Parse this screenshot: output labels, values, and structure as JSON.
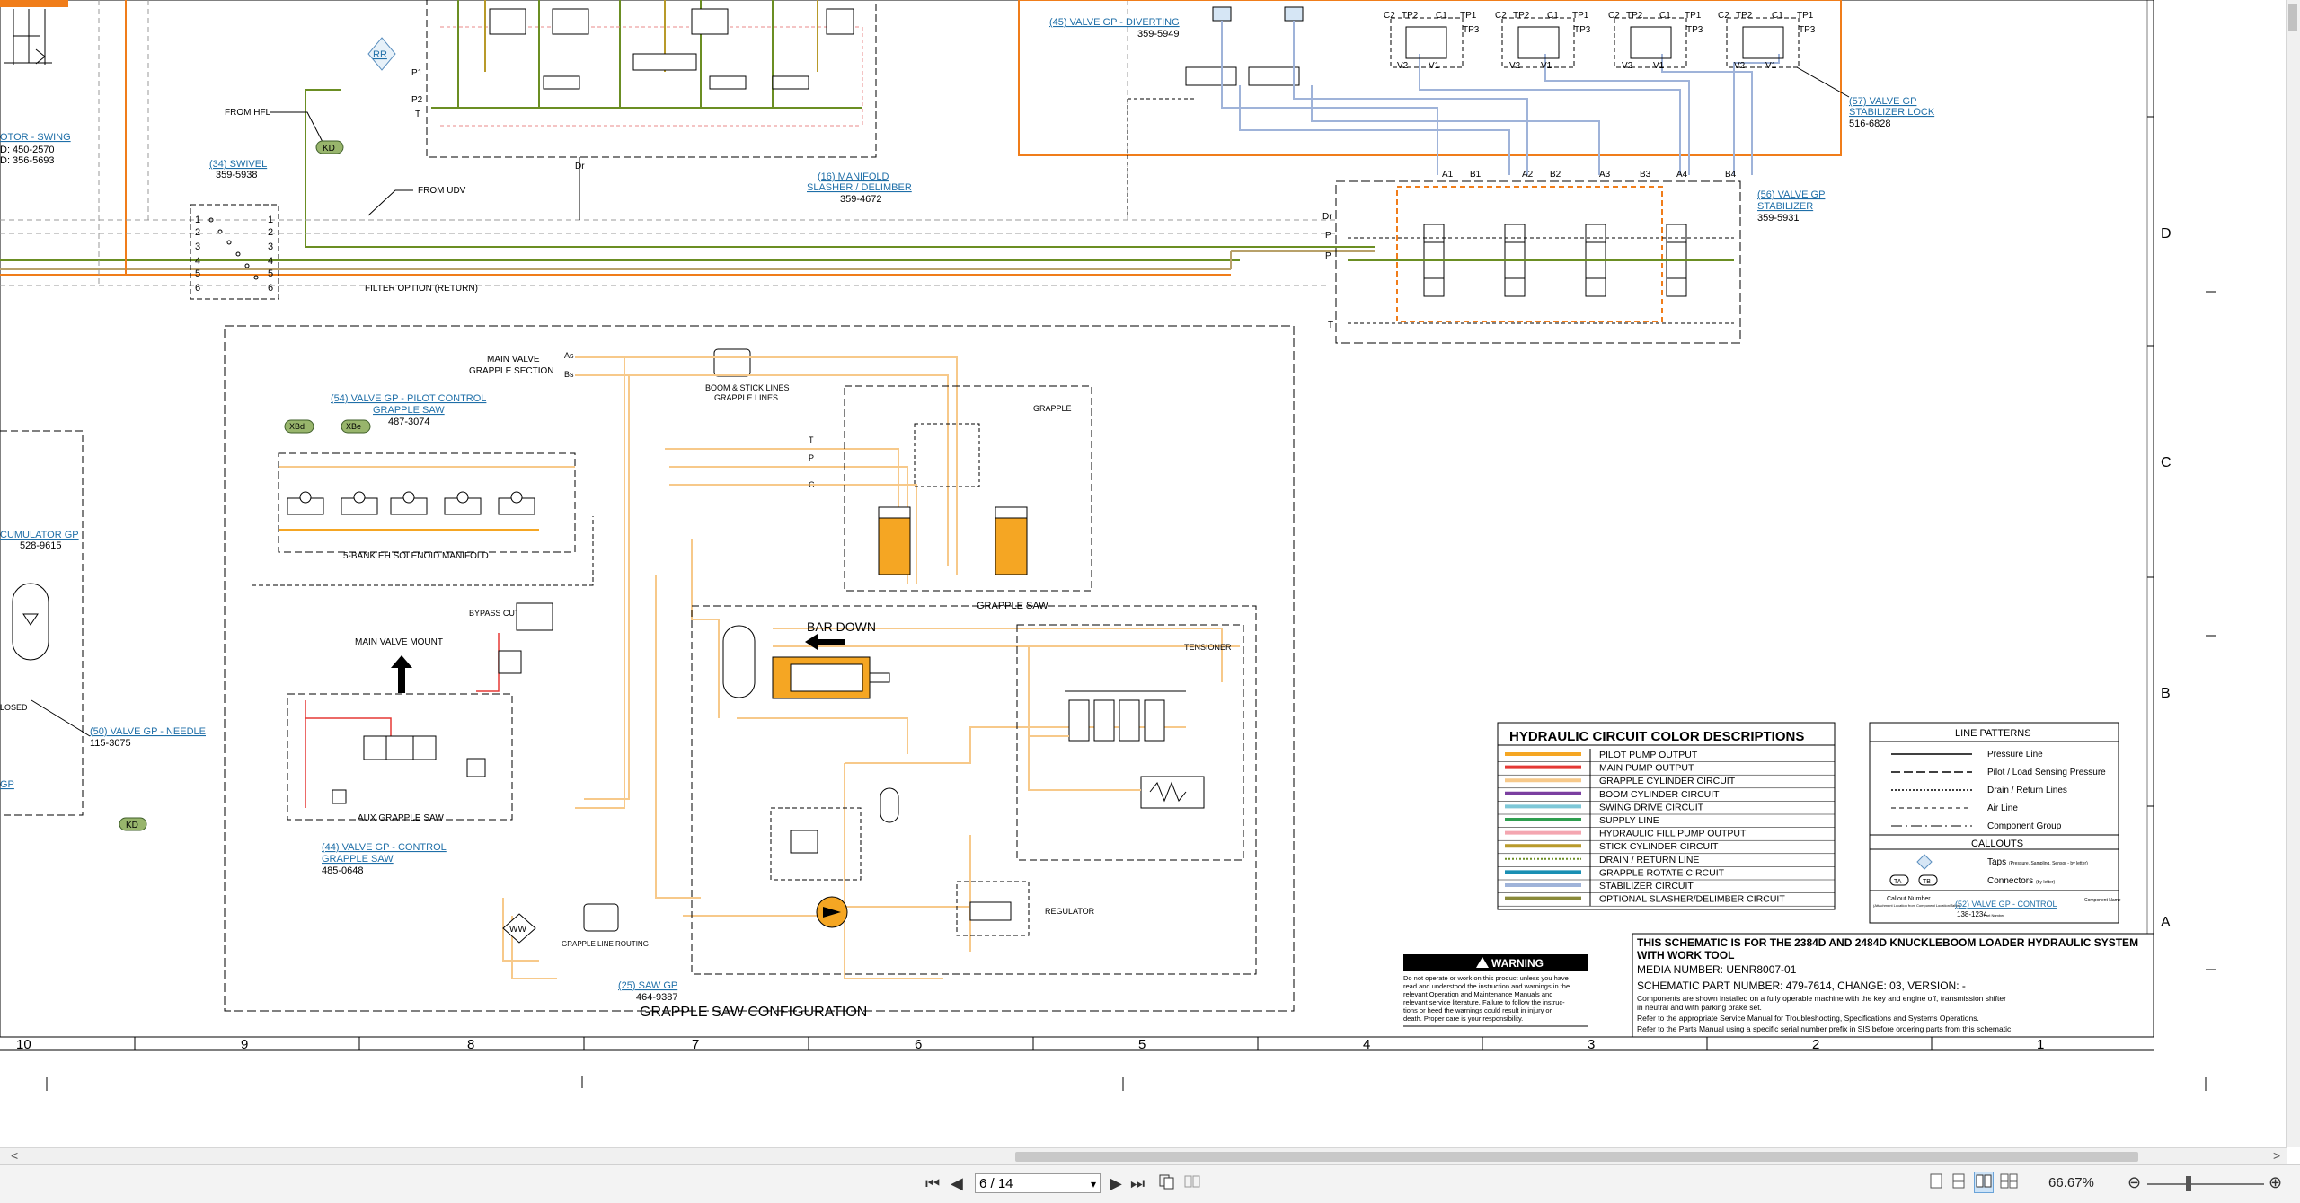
{
  "viewer": {
    "page_current": "6 / 14",
    "zoom": "66.67%",
    "buttons": {
      "first_page": "⏮",
      "prev_page": "◀",
      "next_page": "▶",
      "last_page": "⏭",
      "page_dropdown": "▾",
      "zoom_out": "⊖",
      "zoom_in": "⊕"
    },
    "scroll_left": "<",
    "scroll_right": ">"
  },
  "schematic": {
    "labels": {
      "motor_swing": "OTOR - SWING",
      "motor_part1": "D: 450-2570",
      "motor_part2": "D: 356-5693",
      "rr": "RR",
      "from_hfl": "FROM HFL",
      "kd1": "KD",
      "kd2": "KD",
      "swivel": "(34) SWIVEL",
      "swivel_part": "359-5938",
      "from_udv": "FROM UDV",
      "filter_option": "FILTER OPTION (RETURN)",
      "dr1": "Dr",
      "manifold": "(16) MANIFOLD",
      "manifold2": "SLASHER / DELIMBER",
      "manifold_part": "359-4672",
      "valve_diverting": "(45) VALVE GP - DIVERTING",
      "valve_diverting_part": "359-5949",
      "stab_lock": "(57) VALVE GP",
      "stab_lock2": "STABILIZER LOCK",
      "stab_lock_part": "516-6828",
      "valve_stab": "(56) VALVE GP",
      "valve_stab2": "STABILIZER",
      "valve_stab_part": "359-5931",
      "main_valve": "MAIN VALVE",
      "grapple_section": "GRAPPLE SECTION",
      "boom_stick": "BOOM & STICK LINES",
      "grapple_lines": "GRAPPLE LINES",
      "pilot_control": "(54) VALVE GP - PILOT CONTROL",
      "pilot_control2": "GRAPPLE SAW",
      "pilot_control_part": "487-3074",
      "five_bank": "5-BANK EH SOLENOID MANIFOLD",
      "grapple": "GRAPPLE",
      "accumulator": "CUMULATOR GP",
      "accumulator_part": "528-9615",
      "bypass_cut": "BYPASS CUT",
      "main_valve_mount": "MAIN VALVE MOUNT",
      "grapple_saw_box": "GRAPPLE SAW",
      "bar_down": "BAR DOWN",
      "tensioner": "TENSIONER",
      "needle": "(50) VALVE GP - NEEDLE",
      "needle_part": "115-3075",
      "closed": "LOSED",
      "gp": "GP",
      "aux_grapple": "AUX GRAPPLE SAW",
      "valve_control": "(44) VALVE GP - CONTROL",
      "valve_control2": "GRAPPLE SAW",
      "valve_control_part": "485-0648",
      "regulator": "REGULATOR",
      "ww": "WW",
      "grapple_line_routing": "GRAPPLE LINE ROUTING",
      "saw_gp": "(25) SAW GP",
      "saw_gp_part": "464-9387",
      "grapple_saw_config": "GRAPPLE SAW CONFIGURATION",
      "xbd": "XBd",
      "xbe": "XBe"
    },
    "color_table": {
      "title": "HYDRAULIC CIRCUIT COLOR DESCRIPTIONS",
      "rows": [
        {
          "label": "PILOT PUMP OUTPUT",
          "color": "#f5a623",
          "style": "solid"
        },
        {
          "label": "MAIN PUMP OUTPUT",
          "color": "#e53935",
          "style": "solid"
        },
        {
          "label": "GRAPPLE CYLINDER CIRCUIT",
          "color": "#f7c98a",
          "style": "solid"
        },
        {
          "label": "BOOM CYLINDER CIRCUIT",
          "color": "#7b3fa0",
          "style": "solid"
        },
        {
          "label": "SWING DRIVE CIRCUIT",
          "color": "#7ec8d8",
          "style": "solid"
        },
        {
          "label": "SUPPLY LINE",
          "color": "#2e9e4f",
          "style": "solid"
        },
        {
          "label": "HYDRAULIC FILL PUMP OUTPUT",
          "color": "#f4a6b0",
          "style": "solid"
        },
        {
          "label": "STICK CYLINDER CIRCUIT",
          "color": "#b89a2a",
          "style": "solid"
        },
        {
          "label": "DRAIN / RETURN LINE",
          "color": "#6b8e23",
          "style": "dotted"
        },
        {
          "label": "GRAPPLE ROTATE CIRCUIT",
          "color": "#1a8fb3",
          "style": "solid"
        },
        {
          "label": "STABILIZER CIRCUIT",
          "color": "#9fb3d9",
          "style": "solid"
        },
        {
          "label": "OPTIONAL SLASHER/DELIMBER CIRCUIT",
          "color": "#8a8a3a",
          "style": "solid"
        }
      ]
    },
    "line_patterns": {
      "title": "LINE PATTERNS",
      "rows": [
        "Pressure Line",
        "Pilot / Load Sensing Pressure",
        "Drain / Return Lines",
        "Air Line",
        "Component Group"
      ],
      "callouts_title": "CALLOUTS",
      "callouts": [
        {
          "label": "Taps",
          "sub": "(Pressure, Sampling, Sensor - by letter)"
        },
        {
          "label": "Connectors",
          "sub": "(by letter)"
        }
      ],
      "callout_number": "Callout Number",
      "callout_sub": "(Attachment Location from Component Location/Table)",
      "callout_example": "(52) VALVE GP - CONTROL",
      "callout_example_part": "138-1234",
      "part_number": "Part Number",
      "component_name": "Component Name",
      "tp_a": "TA",
      "tp_b": "TB"
    },
    "warning": {
      "title": "WARNING",
      "text1": "Do not operate or work on this product unless you have",
      "text2": "read and understood the instruction and warnings in the",
      "text3": "relevant Operation and Maintenance Manuals and",
      "text4": "relevant service literature. Failure to follow the instruc-",
      "text5": "tions or heed the warnings could result in injury or",
      "text6": "death. Proper care is your responsibility."
    },
    "title_block": {
      "line1": "THIS SCHEMATIC IS FOR THE 2384D AND 2484D KNUCKLEBOOM LOADER HYDRAULIC SYSTEM",
      "line2": "WITH WORK TOOL",
      "line3": "MEDIA NUMBER: UENR8007-01",
      "line4": "SCHEMATIC PART NUMBER: 479-7614, CHANGE: 03, VERSION: -",
      "line5": "Components are shown installed on a fully operable machine with the key and engine off, transmission shifter",
      "line6": "in neutral and with parking brake set.",
      "line7": "Refer to the appropriate Service Manual for Troubleshooting, Specifications and Systems Operations.",
      "line8": "Refer to the Parts Manual using a specific serial number prefix in SIS before ordering parts from this schematic."
    },
    "grid_cols": [
      "10",
      "9",
      "8",
      "7",
      "6",
      "5",
      "4",
      "3",
      "2",
      "1"
    ],
    "grid_rows": [
      "D",
      "C",
      "B",
      "A"
    ],
    "stab_ports": [
      "A1",
      "B1",
      "A2",
      "B2",
      "A3",
      "B3",
      "A4",
      "B4"
    ],
    "cyl_labels": [
      "C2",
      "TP2",
      "C1",
      "TP1",
      "TP3",
      "V2",
      "V1"
    ],
    "swivel_ports": [
      "1",
      "2",
      "3",
      "4",
      "5",
      "6"
    ]
  }
}
